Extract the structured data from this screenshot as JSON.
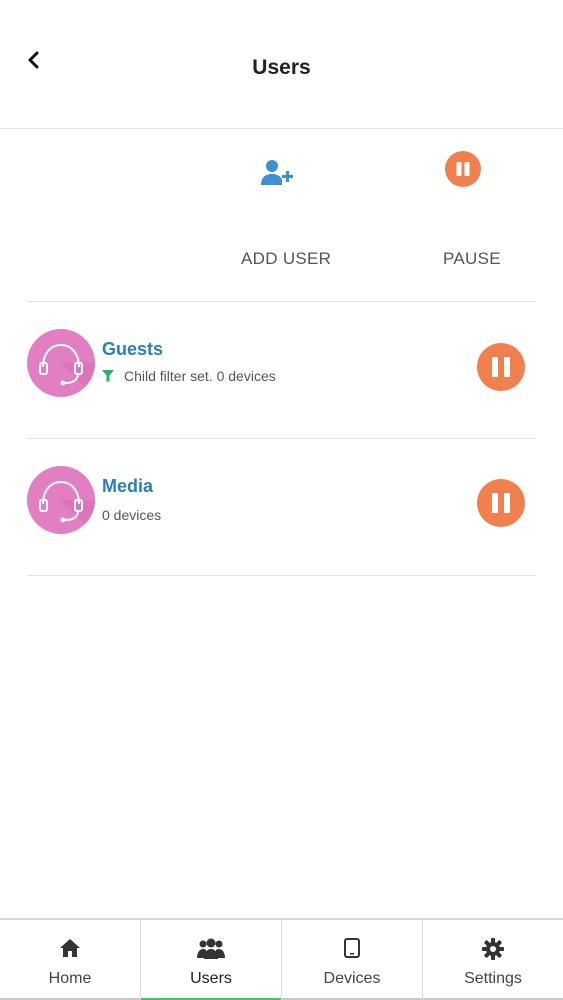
{
  "header": {
    "title": "Users",
    "back_icon": "chevron-left-icon"
  },
  "actions": {
    "add_user": {
      "label": "ADD USER",
      "icon": "add-user-icon",
      "color": "#3a8fd6"
    },
    "pause": {
      "label": "PAUSE",
      "icon": "pause-icon",
      "color": "#f0814f"
    }
  },
  "users": [
    {
      "name": "Guests",
      "subtitle": "Child filter set. 0 devices",
      "has_filter": true,
      "avatar_icon": "headset-icon"
    },
    {
      "name": "Media",
      "subtitle": "0 devices",
      "has_filter": false,
      "avatar_icon": "headset-icon"
    }
  ],
  "tabs": [
    {
      "label": "Home",
      "icon": "home-icon",
      "active": false
    },
    {
      "label": "Users",
      "icon": "users-icon",
      "active": true
    },
    {
      "label": "Devices",
      "icon": "tablet-icon",
      "active": false
    },
    {
      "label": "Settings",
      "icon": "gear-icon",
      "active": false
    }
  ],
  "colors": {
    "accent_blue": "#2a7fc1",
    "pause_orange": "#f0814f",
    "avatar_pink": "#e27fc2",
    "active_tab": "#33cc66",
    "filter_green": "#27b36b"
  }
}
